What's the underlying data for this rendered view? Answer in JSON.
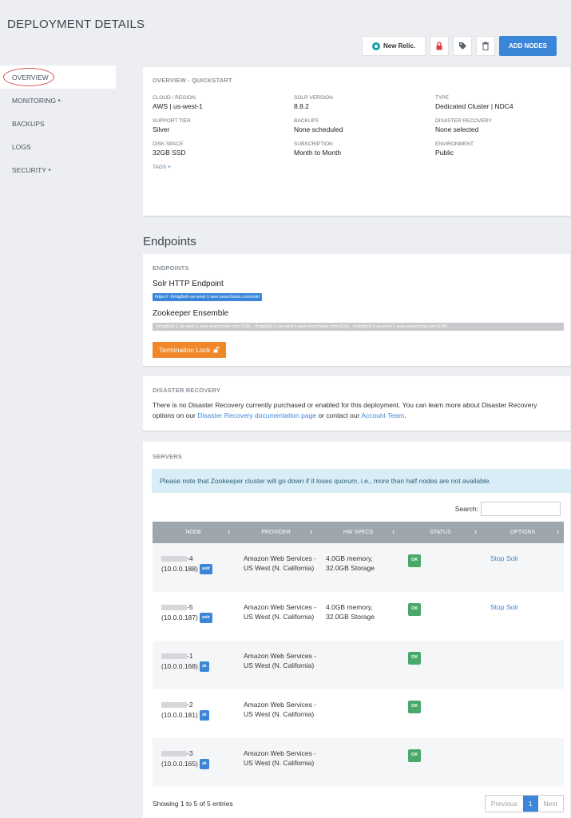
{
  "page": {
    "title": "DEPLOYMENT DETAILS"
  },
  "toolbar": {
    "new_relic_label": "New Relic.",
    "add_nodes_label": "ADD NODES",
    "colors": {
      "primary": "#3b86d9",
      "lock": "#e23c3c"
    }
  },
  "sidebar": {
    "items": [
      {
        "label": "OVERVIEW",
        "active": true
      },
      {
        "label": "MONITORING",
        "caret": "▸"
      },
      {
        "label": "BACKUPS"
      },
      {
        "label": "LOGS"
      },
      {
        "label": "SECURITY",
        "caret": "▸"
      }
    ]
  },
  "overview": {
    "heading": "OVERVIEW - QUICKSTART",
    "fields": [
      {
        "label": "CLOUD / REGION",
        "value": "AWS | us-west-1"
      },
      {
        "label": "SOLR VERSION",
        "value": "8.8.2"
      },
      {
        "label": "TYPE",
        "value": "Dedicated Cluster | NDC4"
      },
      {
        "label": "SUPPORT TIER",
        "value": "Silver"
      },
      {
        "label": "BACKUPS",
        "value": "None scheduled"
      },
      {
        "label": "DISASTER RECOVERY",
        "value": "None selected"
      },
      {
        "label": "DISK SPACE",
        "value": "32GB SSD"
      },
      {
        "label": "SUBSCRIPTION",
        "value": "Month to Month"
      },
      {
        "label": "ENVIRONMENT",
        "value": "Public"
      }
    ],
    "tags_label": "TAGS",
    "tags_add": "+"
  },
  "endpoints": {
    "section_title": "Endpoints",
    "heading": "ENDPOINTS",
    "solr_label": "Solr HTTP Endpoint",
    "solr_url": "https://            -0mtg8zi6-us-west-1-aws.searchstax.com/solr/",
    "zk_label": "Zookeeper Ensemble",
    "zk_url": "               -0mtg8zi6-1-us-west-1-aws.searchstax.com:2181,               -0mtg8zi6-2-us-west-1-aws.searchstax.com:2181,               -0mtg8zi6-3-us-west-1-aws.searchstax.com:2181",
    "termination_label": "Termination Lock"
  },
  "disaster_recovery": {
    "heading": "DISASTER RECOVERY",
    "text_before": "There is no Disaster Recovery currently purchased or enabled for this deployment. You can learn more about Disaster Recovery options on our ",
    "doc_link": "Disaster Recovery documentation page",
    "text_middle": " or contact our ",
    "team_link": "Account Team",
    "text_after": "."
  },
  "servers": {
    "heading": "SERVERS",
    "note": "Please note that Zookeeper cluster will go down if it loses quorum, i.e., more than half nodes are not available.",
    "search_label": "Search:",
    "columns": [
      "NODE",
      "PROVIDER",
      "HW SPECS",
      "STATUS",
      "OPTIONS"
    ],
    "rows": [
      {
        "suffix": "-4",
        "ip": "(10.0.0.188)",
        "badge": "solr",
        "provider": "Amazon Web Services - US West (N. California)",
        "hw1": "4.0GB memory,",
        "hw2": "32.0GB Storage",
        "status": "OK",
        "option": "Stop Solr"
      },
      {
        "suffix": "-5",
        "ip": "(10.0.0.187)",
        "badge": "solr",
        "provider": "Amazon Web Services - US West (N. California)",
        "hw1": "4.0GB memory,",
        "hw2": "32.0GB Storage",
        "status": "OK",
        "option": "Stop Solr"
      },
      {
        "suffix": "-1",
        "ip": "(10.0.0.168)",
        "badge": "zk",
        "provider": "Amazon Web Services - US West (N. California)",
        "hw1": "",
        "hw2": "",
        "status": "OK",
        "option": ""
      },
      {
        "suffix": "-2",
        "ip": "(10.0.0.181)",
        "badge": "zk",
        "provider": "Amazon Web Services - US West (N. California)",
        "hw1": "",
        "hw2": "",
        "status": "OK",
        "option": ""
      },
      {
        "suffix": "-3",
        "ip": "(10.0.0.165)",
        "badge": "zk",
        "provider": "Amazon Web Services - US West (N. California)",
        "hw1": "",
        "hw2": "",
        "status": "OK",
        "option": ""
      }
    ],
    "showing": "Showing 1 to 5 of 5 entries",
    "pager": {
      "prev": "Previous",
      "current": "1",
      "next": "Next"
    }
  }
}
